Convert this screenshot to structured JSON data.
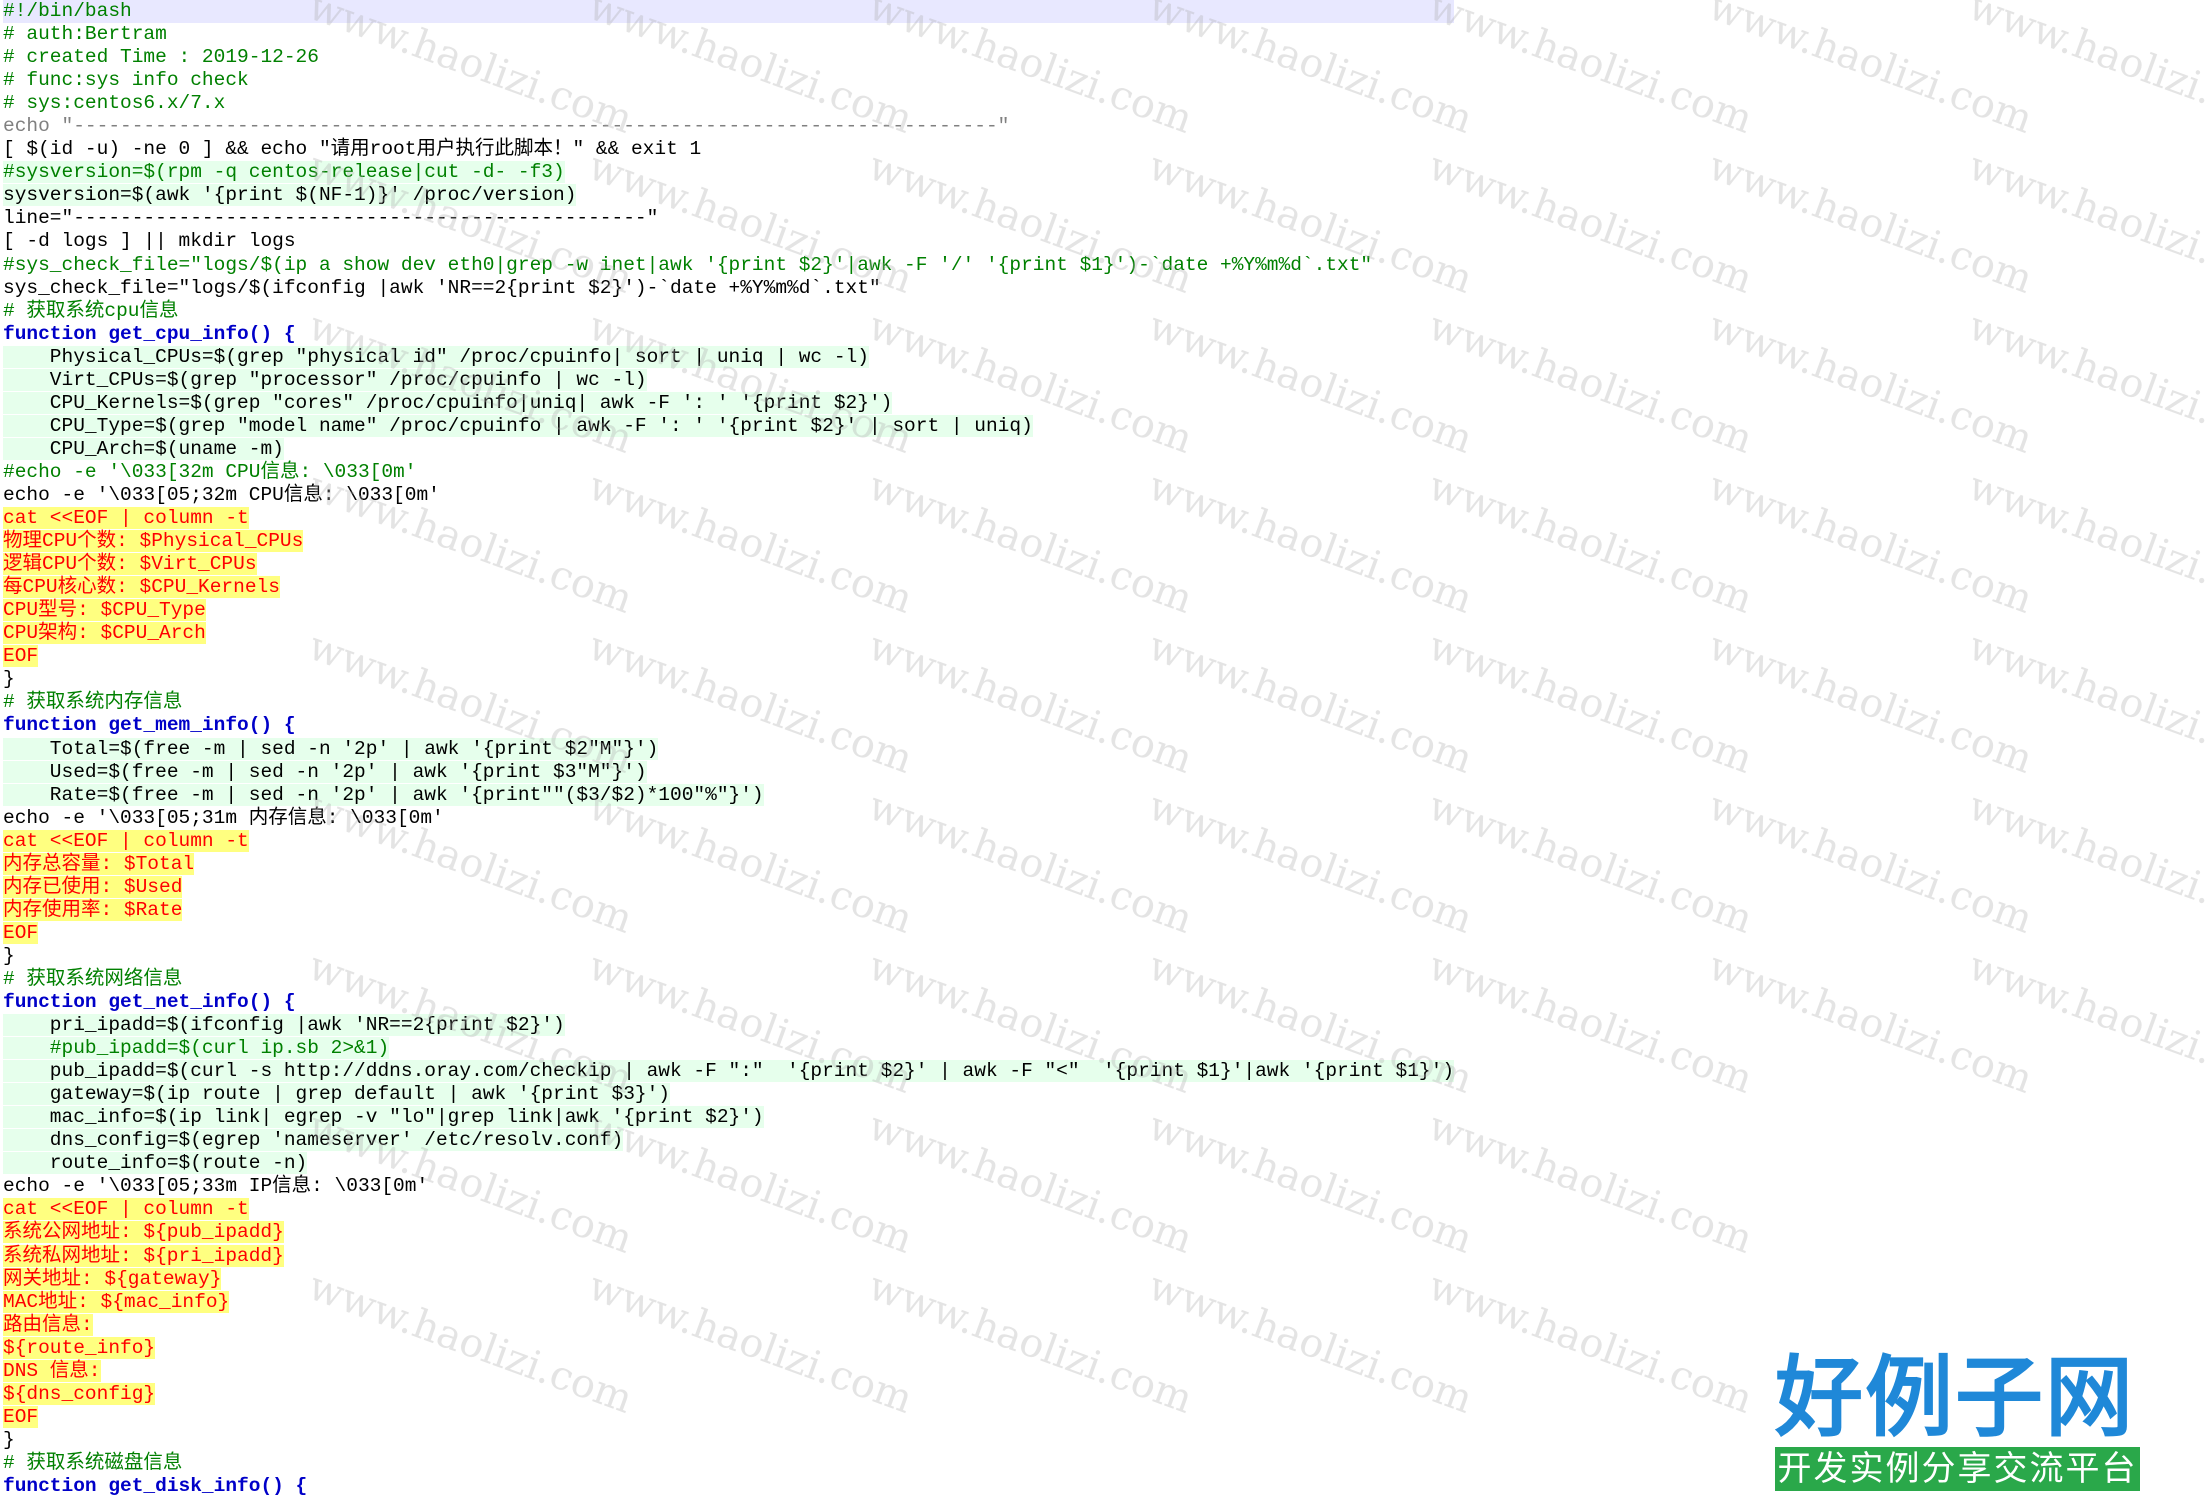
{
  "editor": {
    "lines": [
      "#!/bin/bash",
      "# auth:Bertram",
      "# created Time : 2019-12-26",
      "# func:sys info check",
      "# sys:centos6.x/7.x",
      "echo \"-------------------------------------------------------------------------------\"",
      "[ $(id -u) -ne 0 ] && echo \"请用root用户执行此脚本！\" && exit 1",
      "#sysversion=$(rpm -q centos-release|cut -d- -f3)",
      "sysversion=$(awk '{print $(NF-1)}' /proc/version)",
      "line=\"-------------------------------------------------\"",
      "[ -d logs ] || mkdir logs",
      "#sys_check_file=\"logs/$(ip a show dev eth0|grep -w inet|awk '{print $2}'|awk -F '/' '{print $1}')-`date +%Y%m%d`.txt\"",
      "sys_check_file=\"logs/$(ifconfig |awk 'NR==2{print $2}')-`date +%Y%m%d`.txt\"",
      "# 获取系统cpu信息",
      "function get_cpu_info() {",
      "    Physical_CPUs=$(grep \"physical id\" /proc/cpuinfo| sort | uniq | wc -l)",
      "    Virt_CPUs=$(grep \"processor\" /proc/cpuinfo | wc -l)",
      "    CPU_Kernels=$(grep \"cores\" /proc/cpuinfo|uniq| awk -F ': ' '{print $2}')",
      "    CPU_Type=$(grep \"model name\" /proc/cpuinfo | awk -F ': ' '{print $2}' | sort | uniq)",
      "    CPU_Arch=$(uname -m)",
      "#echo -e '\\033[32m CPU信息: \\033[0m'",
      "echo -e '\\033[05;32m CPU信息: \\033[0m'",
      "cat <<EOF | column -t",
      "物理CPU个数: $Physical_CPUs",
      "逻辑CPU个数: $Virt_CPUs",
      "每CPU核心数: $CPU_Kernels",
      "CPU型号: $CPU_Type",
      "CPU架构: $CPU_Arch",
      "EOF",
      "}",
      "# 获取系统内存信息",
      "function get_mem_info() {",
      "    Total=$(free -m | sed -n '2p' | awk '{print $2\"M\"}')",
      "    Used=$(free -m | sed -n '2p' | awk '{print $3\"M\"}')",
      "    Rate=$(free -m | sed -n '2p' | awk '{print\"\"($3/$2)*100\"%\"}')",
      "echo -e '\\033[05;31m 内存信息: \\033[0m'",
      "cat <<EOF | column -t",
      "内存总容量: $Total",
      "内存已使用: $Used",
      "内存使用率: $Rate",
      "EOF",
      "}",
      "# 获取系统网络信息",
      "function get_net_info() {",
      "    pri_ipadd=$(ifconfig |awk 'NR==2{print $2}')",
      "    #pub_ipadd=$(curl ip.sb 2>&1)",
      "    pub_ipadd=$(curl -s http://ddns.oray.com/checkip | awk -F \":\"  '{print $2}' | awk -F \"<\"  '{print $1}'|awk '{print $1}')",
      "    gateway=$(ip route | grep default | awk '{print $3}')",
      "    mac_info=$(ip link| egrep -v \"lo\"|grep link|awk '{print $2}')",
      "    dns_config=$(egrep 'nameserver' /etc/resolv.conf)",
      "    route_info=$(route -n)",
      "echo -e '\\033[05;33m IP信息: \\033[0m'",
      "cat <<EOF | column -t",
      "系统公网地址: ${pub_ipadd}",
      "系统私网地址: ${pri_ipadd}",
      "网关地址: ${gateway}",
      "MAC地址: ${mac_info}",
      "路由信息:",
      "${route_info}",
      "DNS 信息:",
      "${dns_config}",
      "EOF",
      "}",
      "# 获取系统磁盘信息",
      "function get_disk_info() {"
    ]
  },
  "watermark": {
    "text": "www.haolizi.com"
  },
  "logo": {
    "title": "好例子网",
    "subtitle": "开发实例分享交流平台",
    "title_color": "#1f88d8",
    "subtitle_bg": "#2aa84a"
  }
}
